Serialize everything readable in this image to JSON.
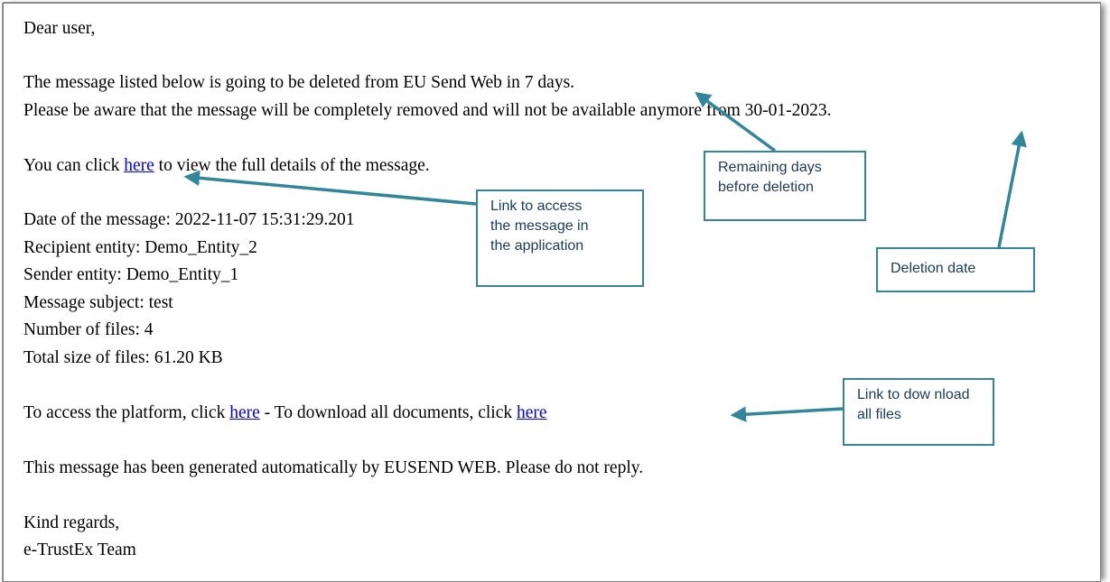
{
  "email": {
    "greeting": "Dear user,",
    "deletion_notice": "The message listed below is going to be deleted from EU Send Web in 7 days.",
    "removal_notice": "Please be aware that the message will be completely removed and will not be available anymore from 30-01-2023.",
    "view_prefix": "You can click ",
    "view_link": "here",
    "view_suffix": " to view the full details of the message.",
    "details": [
      "Date of the message: 2022-11-07 15:31:29.201",
      "Recipient entity: Demo_Entity_2",
      "Sender entity: Demo_Entity_1",
      "Message subject: test",
      "Number of files: 4",
      "Total size of files: 61.20 KB"
    ],
    "access_prefix": "To access the platform, click ",
    "access_link": "here",
    "download_middle": " - To download all documents, click ",
    "download_link": "here",
    "auto_notice": "This message has been generated automatically by EUSEND WEB. Please do not reply.",
    "closing": "Kind regards,",
    "signature": "e-TrustEx Team"
  },
  "callouts": {
    "view_link": [
      "Link to access",
      "the message in",
      "the application"
    ],
    "remaining_days": [
      "Remaining  days",
      "before deletion"
    ],
    "deletion_date": [
      "Deletion date"
    ],
    "download_link": [
      "Link to dow nload",
      "all files"
    ]
  },
  "colors": {
    "callout_border": "#31859c",
    "arrow": "#31859c",
    "link": "#0000ee"
  }
}
